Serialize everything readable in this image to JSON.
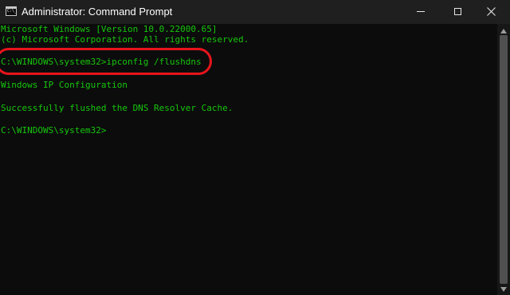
{
  "window": {
    "title": "Administrator: Command Prompt",
    "icon": "C:\\_",
    "controls": {
      "minimize": "minimize-icon",
      "maximize": "maximize-icon",
      "close": "close-icon"
    }
  },
  "console": {
    "lines": [
      "Microsoft Windows [Version 10.0.22000.65]",
      "(c) Microsoft Corporation. All rights reserved.",
      "",
      "C:\\WINDOWS\\system32>ipconfig /flushdns",
      "",
      "Windows IP Configuration",
      "",
      "Successfully flushed the DNS Resolver Cache.",
      "",
      "C:\\WINDOWS\\system32>"
    ],
    "text_color": "#16c60c",
    "background": "#0c0c0c",
    "highlight_color": "#e8141c"
  }
}
